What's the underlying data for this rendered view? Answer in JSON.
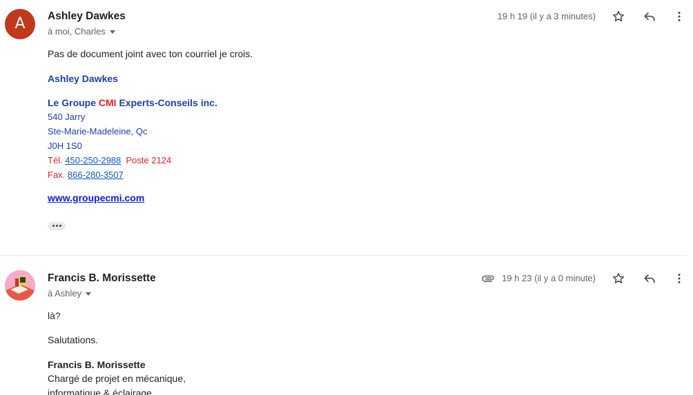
{
  "messages": [
    {
      "avatar_letter": "A",
      "sender": "Ashley Dawkes",
      "recipients": "à moi, Charles",
      "time": "19 h 19 (il y a 3 minutes)",
      "text": "Pas de document joint avec ton courriel je crois.",
      "signature": {
        "name": "Ashley Dawkes",
        "company_prefix": "Le Groupe ",
        "company_highlight": "CMI",
        "company_suffix": " Experts-Conseils inc.",
        "address1": "540 Jarry",
        "address2": "Ste-Marie-Madeleine, Qc",
        "postal": "J0H 1S0",
        "tel_label": "Tél. ",
        "tel_number": "450-250-2988",
        "tel_ext": "  Poste 2124",
        "fax_label": "Fax. ",
        "fax_number": "866-280-3507",
        "website": "www.groupecmi.com"
      }
    },
    {
      "sender": "Francis B. Morissette",
      "recipients": "à Ashley",
      "time": "19 h 23 (il y a 0 minute)",
      "line1": "là?",
      "line2": "Salutations.",
      "signature_name": "Francis B. Morissette",
      "title1": "Chargé de projet en mécanique,",
      "title2": "informatique & éclairage"
    }
  ]
}
